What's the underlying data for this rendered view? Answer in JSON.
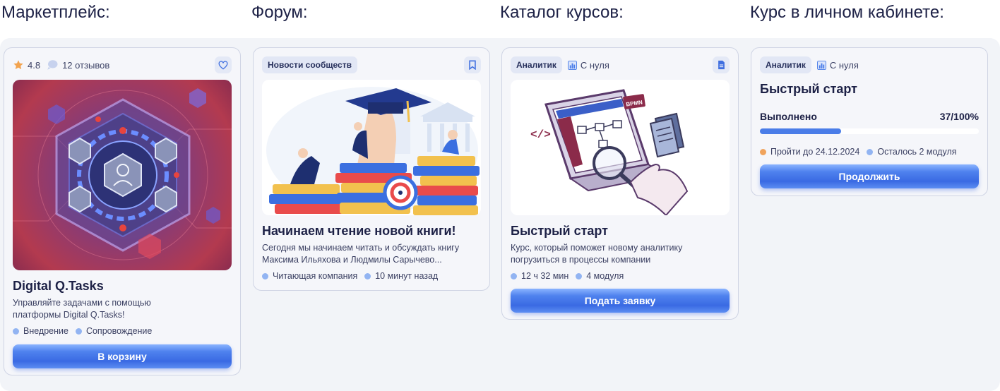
{
  "headings": {
    "marketplace": "Маркетплейс:",
    "forum": "Форум:",
    "catalog": "Каталог курсов:",
    "cabinet": "Курс в личном кабинете:"
  },
  "marketplace_card": {
    "rating": "4.8",
    "reviews": "12 отзывов",
    "title": "Digital Q.Tasks",
    "description": "Управляйте задачами с помощью платформы Digital Q.Tasks!",
    "tags": [
      "Внедрение",
      "Сопровождение"
    ],
    "button": "В корзину",
    "icons": {
      "rating": "star-icon",
      "reviews": "chat-bubble-icon",
      "favorite": "heart-icon"
    }
  },
  "forum_card": {
    "badge": "Новости сообществ",
    "title": "Начинаем чтение новой книги!",
    "description": "Сегодня мы начинаем читать и обсуждать книгу Максима Ильяхова и Людмилы Сарычево...",
    "tags": [
      "Читающая компания",
      "10 минут назад"
    ],
    "icons": {
      "bookmark": "bookmark-icon"
    }
  },
  "catalog_card": {
    "badge": "Аналитик",
    "level": "С нуля",
    "image_label": "BPMN",
    "title": "Быстрый старт",
    "description": "Курс, который поможет новому аналитику погрузиться в процессы компании",
    "tags": [
      "12 ч 32 мин",
      "4 модуля"
    ],
    "button": "Подать заявку",
    "icons": {
      "level": "bar-chart-icon",
      "document": "document-icon"
    }
  },
  "cabinet_card": {
    "badge": "Аналитик",
    "level": "С нуля",
    "title": "Быстрый старт",
    "progress_label": "Выполнено",
    "progress_value": "37/100%",
    "progress_fraction": 0.37,
    "deadline": "Пройти до 24.12.2024",
    "remaining": "Осталось 2 модуля",
    "button": "Продолжить"
  },
  "colors": {
    "accent": "#4a7de8",
    "card_bg": "#f5f6fa",
    "chip_bg": "#e2e7f5",
    "dot_blue": "#92b4f2",
    "dot_orange": "#f0a35c"
  }
}
